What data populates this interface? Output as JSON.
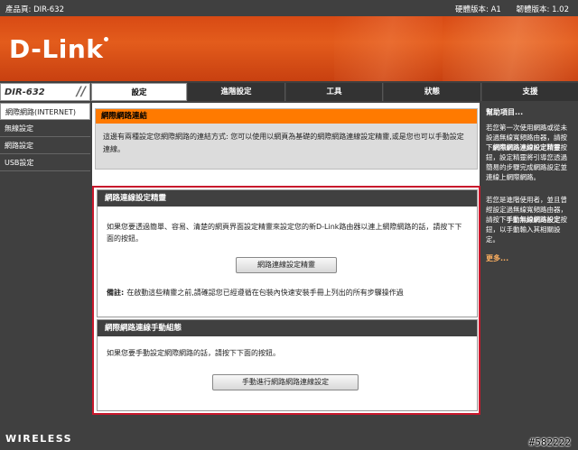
{
  "header": {
    "product_label": "產品頁: DIR-632",
    "hw_version": "硬體版本: A1",
    "fw_version": "韌體版本: 1.02"
  },
  "brand": {
    "logo_text": "D-Link",
    "accent_color": "#ff7a00",
    "banner_color": "#e35c1c"
  },
  "model": "DIR-632",
  "tabs": [
    {
      "label": "設定",
      "active": true
    },
    {
      "label": "進階設定"
    },
    {
      "label": "工具"
    },
    {
      "label": "狀態"
    },
    {
      "label": "支援"
    }
  ],
  "sidebar": {
    "items": [
      {
        "label": "網際網路(INTERNET)",
        "active": true
      },
      {
        "label": "無線設定"
      },
      {
        "label": "網路設定"
      },
      {
        "label": "USB設定"
      }
    ]
  },
  "intro": {
    "title": "網際網路連結",
    "text": "這邊有兩種設定您網際網路的連結方式: 您可以使用以網頁為基礎的網際網路連線設定精靈,或是您也可以手動設定連線。"
  },
  "wizard": {
    "title": "網路連線設定精靈",
    "text": "如果您要透過簡單、容易、清楚的網頁界面設定精靈來設定您的新D-Link路由器以連上網際網路的話，請按下下面的按鈕。",
    "button": "網路連線設定精靈",
    "note_label": "備註:",
    "note_text": "在啟動這些精靈之前,請確認您已經遵循在包裝內快速安裝手冊上列出的所有步驟操作過"
  },
  "manual": {
    "title": "網際網路連線手動組態",
    "text": "如果您要手動設定網際網路的話，請按下下面的按鈕。",
    "button": "手動進行網路網路連線設定"
  },
  "help": {
    "title": "幫助項目...",
    "p1_a": "若您第一次使用網路或從未設過無線寬頻路由器，請按下",
    "p1_b": "網際網路連線設定精靈",
    "p1_c": "按鈕，設定精靈將引導您透過簡易的步驟完成網路設定並連線上網際網路。",
    "p2_a": "若您是進階使用者，並且曾經設定過無線寬頻路由器，請按下",
    "p2_b": "手動無線網路設定",
    "p2_c": "按鈕，以手動輸入其相關設定。",
    "more": "更多..."
  },
  "footer": {
    "brand": "WIRELESS",
    "watermark": "#582222"
  }
}
